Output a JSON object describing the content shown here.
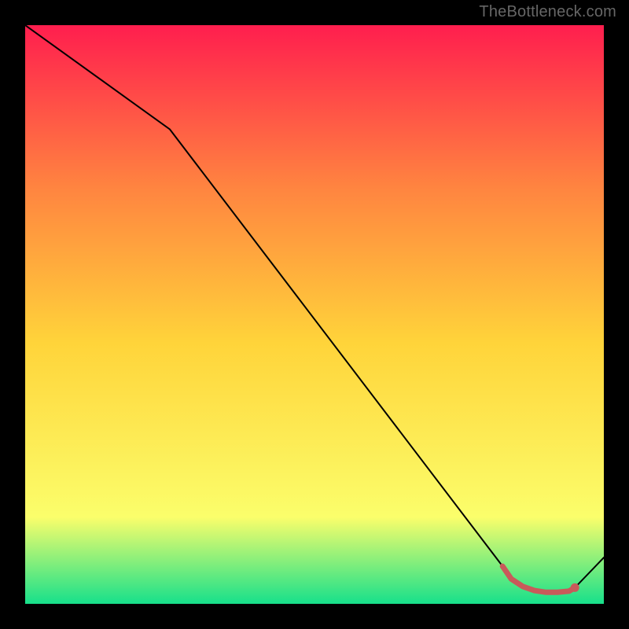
{
  "watermark": "TheBottleneck.com",
  "chart_data": {
    "type": "line",
    "title": "",
    "xlabel": "",
    "ylabel": "",
    "xlim": [
      0,
      100
    ],
    "ylim": [
      0,
      100
    ],
    "grid": false,
    "legend": false,
    "background_gradient": {
      "top": "#FF1E4E",
      "upper_mid": "#FF8440",
      "mid": "#FFD43A",
      "lower_mid": "#FBFE6B",
      "bottom": "#17E08B"
    },
    "series": [
      {
        "name": "main-curve",
        "x": [
          0,
          25,
          82.5,
          84,
          86,
          88,
          90,
          92,
          94,
          95,
          100
        ],
        "y": [
          100,
          82,
          6.5,
          4.3,
          3.0,
          2.3,
          2.0,
          2.0,
          2.2,
          2.8,
          8
        ],
        "color": "#000000",
        "stroke_width": 2
      },
      {
        "name": "highlight-segment",
        "x": [
          82.5,
          84,
          86,
          88,
          90,
          92,
          94,
          95
        ],
        "y": [
          6.5,
          4.3,
          3.0,
          2.3,
          2.0,
          2.0,
          2.2,
          2.8
        ],
        "color": "#C85A5A",
        "stroke_width": 7,
        "marker_end": {
          "x": 95,
          "y": 2.8,
          "r": 5.5
        }
      }
    ]
  }
}
